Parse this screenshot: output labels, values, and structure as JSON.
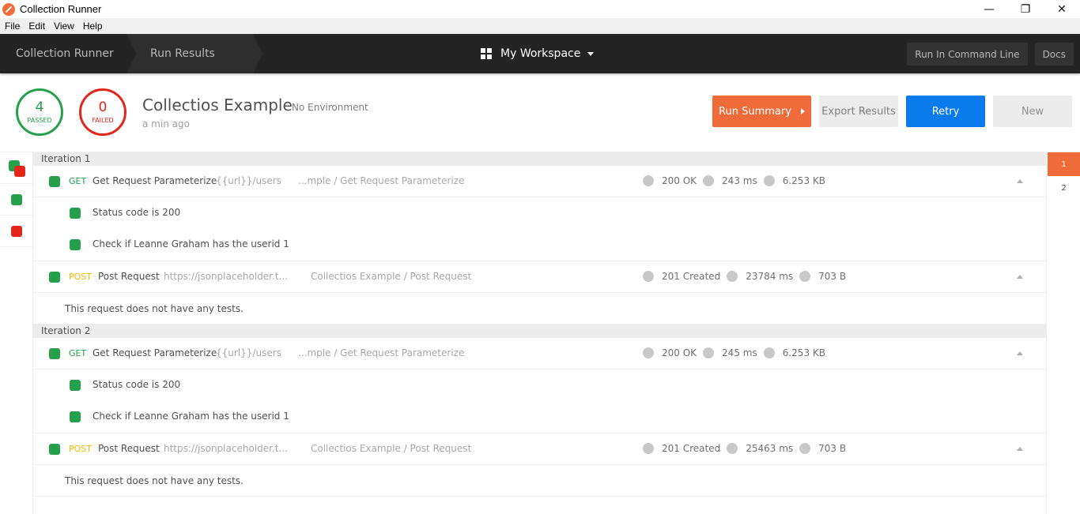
{
  "window": {
    "title": "Collection Runner",
    "controls": {
      "minimize": "—",
      "restore": "❐",
      "close": "✕"
    }
  },
  "menu": [
    "File",
    "Edit",
    "View",
    "Help"
  ],
  "nav": {
    "breadcrumbs": [
      "Collection Runner",
      "Run Results"
    ],
    "workspace": "My Workspace",
    "run_cli": "Run In Command Line",
    "docs": "Docs"
  },
  "summary": {
    "passed_count": "4",
    "passed_label": "PASSED",
    "failed_count": "0",
    "failed_label": "FAILED",
    "collection_name": "Collectios Example",
    "environment": "No Environment",
    "time_ago": "a min ago",
    "buttons": {
      "run_summary": "Run Summary",
      "export": "Export Results",
      "retry": "Retry",
      "new": "New"
    },
    "colors": {
      "passed": "#26a04a",
      "failed": "#e3261b",
      "accent": "#ef6b3a",
      "retry": "#097bed"
    }
  },
  "filters": [
    "all-icon",
    "passed-icon",
    "failed-icon"
  ],
  "iterations": [
    {
      "label": "Iteration 1",
      "requests": [
        {
          "method": "GET",
          "name": "Get Request Parameterize",
          "url": "{{url}}/users",
          "path": "...mple / Get Request Parameterize",
          "status": "200 OK",
          "time": "243 ms",
          "size": "6.253 KB",
          "tests": [
            "Status code is 200",
            "Check if Leanne Graham has the userid 1"
          ]
        },
        {
          "method": "POST",
          "name": "Post Request",
          "url": "https://jsonplaceholder.t...",
          "path": "Collectios Example / Post Request",
          "status": "201 Created",
          "time": "23784 ms",
          "size": "703 B",
          "no_tests": "This request does not have any tests."
        }
      ]
    },
    {
      "label": "Iteration 2",
      "requests": [
        {
          "method": "GET",
          "name": "Get Request Parameterize",
          "url": "{{url}}/users",
          "path": "...mple / Get Request Parameterize",
          "status": "200 OK",
          "time": "245 ms",
          "size": "6.253 KB",
          "tests": [
            "Status code is 200",
            "Check if Leanne Graham has the userid 1"
          ]
        },
        {
          "method": "POST",
          "name": "Post Request",
          "url": "https://jsonplaceholder.t...",
          "path": "Collectios Example / Post Request",
          "status": "201 Created",
          "time": "25463 ms",
          "size": "703 B",
          "no_tests": "This request does not have any tests."
        }
      ]
    }
  ],
  "iteration_tabs": [
    "1",
    "2"
  ],
  "active_iteration": "1"
}
